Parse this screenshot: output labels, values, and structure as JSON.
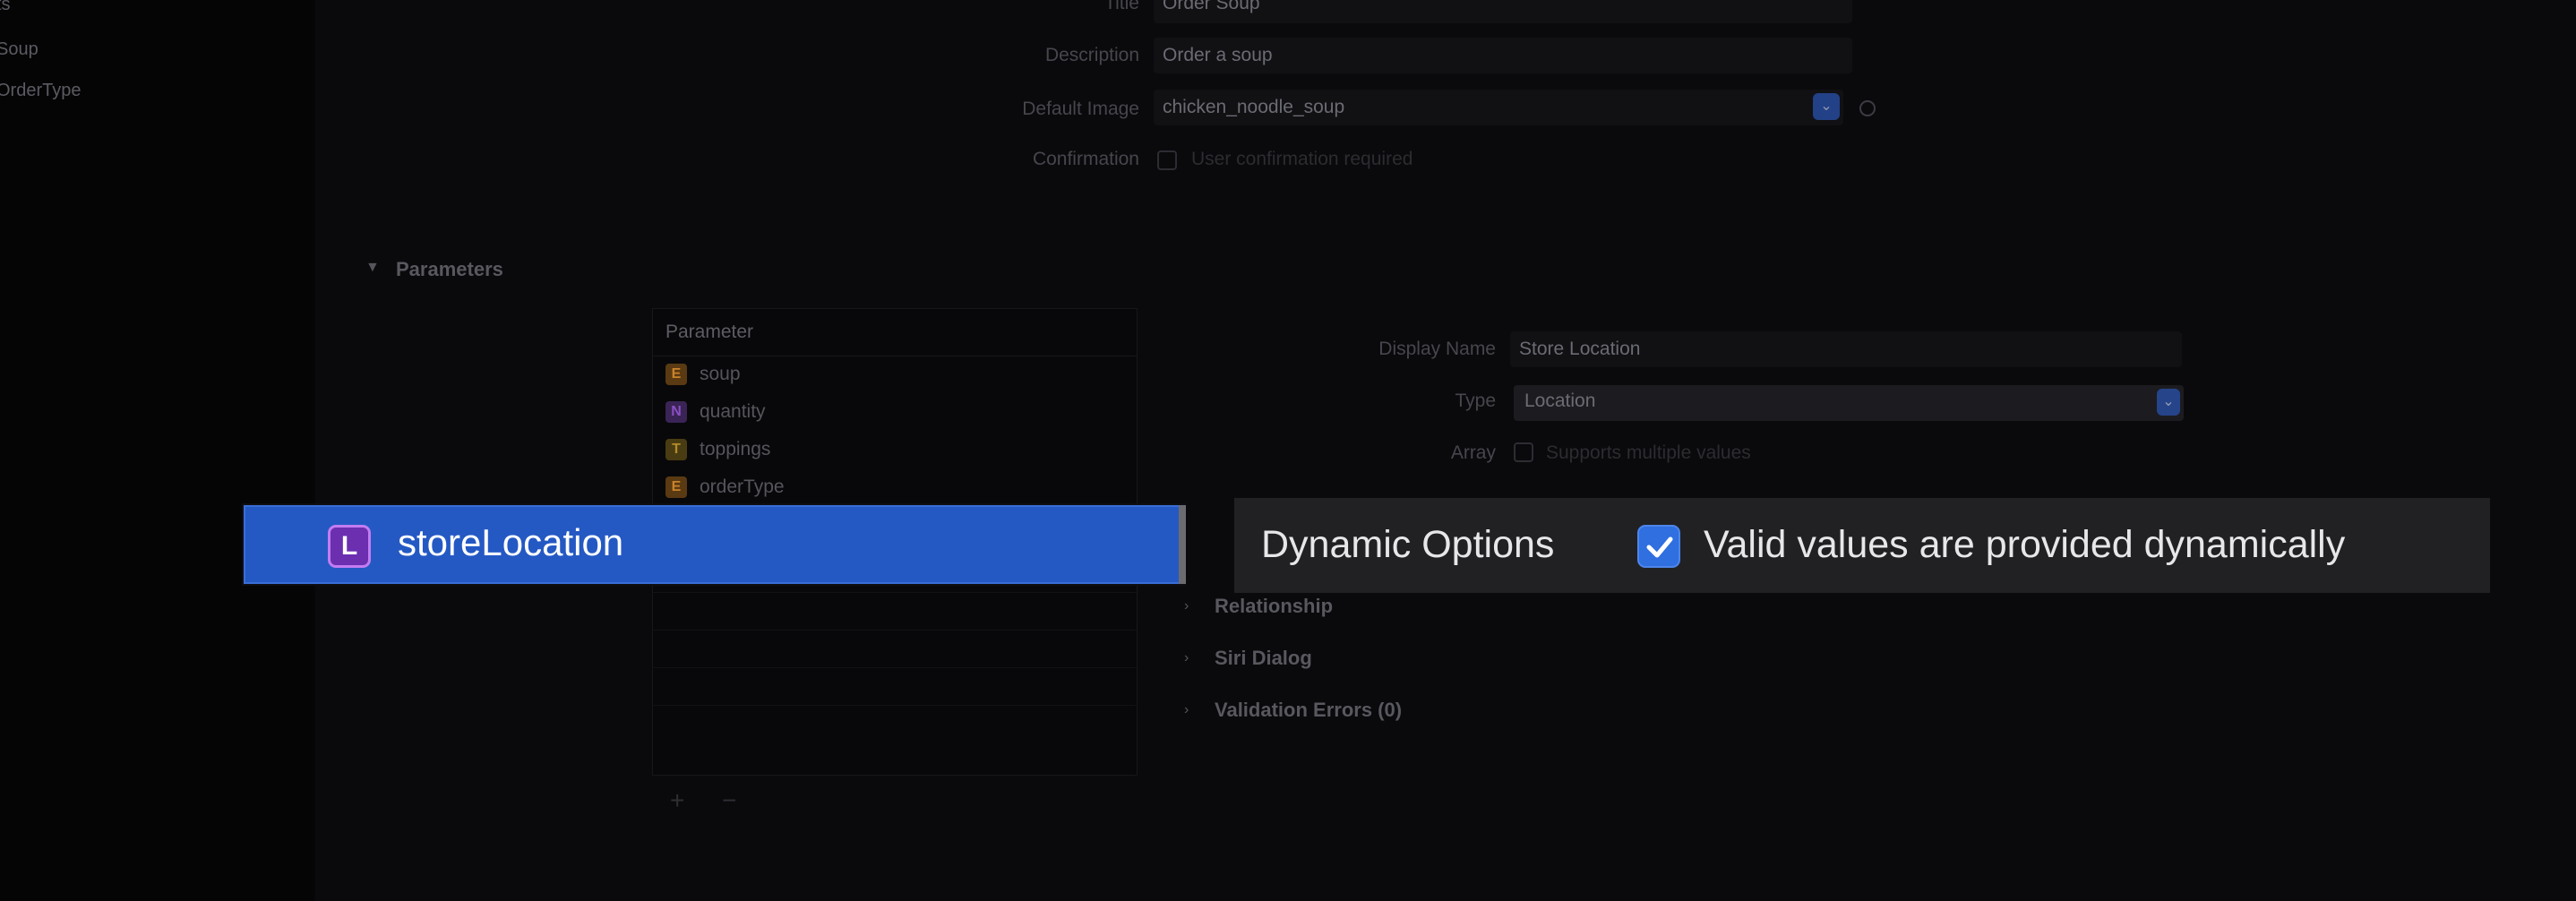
{
  "sidebar": {
    "items": [
      {
        "label": "ts"
      },
      {
        "label": "Soup"
      },
      {
        "label": "OrderType"
      }
    ]
  },
  "intent": {
    "title_label": "Title",
    "title_value": "Order Soup",
    "description_label": "Description",
    "description_value": "Order a soup",
    "default_image_label": "Default Image",
    "default_image_value": "chicken_noodle_soup",
    "confirmation_label": "Confirmation",
    "confirmation_value": "User confirmation required"
  },
  "parameters": {
    "section_title": "Parameters",
    "column_header": "Parameter",
    "rows": [
      {
        "badge": "E",
        "name": "soup",
        "badge_color": "#c9822a"
      },
      {
        "badge": "N",
        "name": "quantity",
        "badge_color": "#8a4fc2"
      },
      {
        "badge": "T",
        "name": "toppings",
        "badge_color": "#b38c2a"
      },
      {
        "badge": "E",
        "name": "orderType",
        "badge_color": "#c9822a"
      }
    ],
    "selected": {
      "badge": "L",
      "name": "storeLocation",
      "badge_color": "#6b2fb0"
    }
  },
  "details": {
    "display_name_label": "Display Name",
    "display_name_value": "Store Location",
    "type_label": "Type",
    "type_value": "Location",
    "array_label": "Array",
    "array_value": "Supports multiple values",
    "dynamic_options_label": "Dynamic Options",
    "dynamic_options_check_label": "Valid values are provided dynamically",
    "dynamic_options_checked": true,
    "sections": [
      "Relationship",
      "Siri Dialog",
      "Validation Errors (0)"
    ]
  },
  "colors": {
    "accent": "#2459c4",
    "checkbox": "#2f6fe0"
  },
  "toolbar": {
    "add_icon": "plus-icon",
    "remove_icon": "minus-icon"
  }
}
